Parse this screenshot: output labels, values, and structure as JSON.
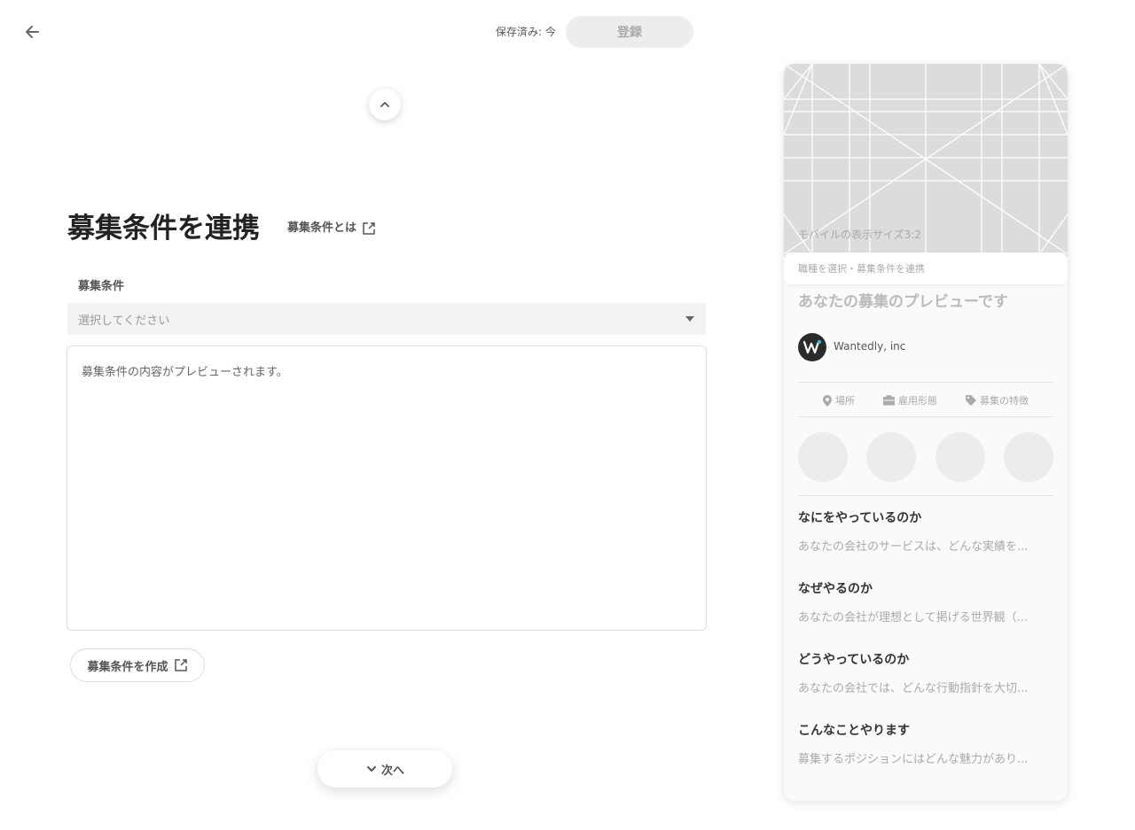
{
  "header": {
    "back_icon": "arrow-left-icon",
    "saved_status": "保存済み: 今",
    "register_label": "登録"
  },
  "main": {
    "title": "募集条件を連携",
    "help_link": "募集条件とは",
    "field_label": "募集条件",
    "select_placeholder": "選択してください",
    "preview_text": "募集条件の内容がプレビューされます。",
    "create_button": "募集条件を作成",
    "next_button": "次へ"
  },
  "preview": {
    "image_caption": "モバイルの表示サイズ3:2",
    "occupation_bar": "職種を選択・募集条件を連携",
    "title": "あなたの募集のプレビューです",
    "company_name": "Wantedly, inc",
    "meta": [
      "場所",
      "雇用形態",
      "募集の特徴"
    ],
    "sections": [
      {
        "title": "なにをやっているのか",
        "text": "あなたの会社のサービスは、どんな実績を..."
      },
      {
        "title": "なぜやるのか",
        "text": "あなたの会社が理想として掲げる世界観（..."
      },
      {
        "title": "どうやっているのか",
        "text": "あなたの会社では、どんな行動指針を大切..."
      },
      {
        "title": "こんなことやります",
        "text": "募集するポジションにはどんな魅力があり..."
      }
    ]
  },
  "colors": {
    "accent_logo": "#2b2b2b",
    "logo_dot": "#21bddb"
  }
}
